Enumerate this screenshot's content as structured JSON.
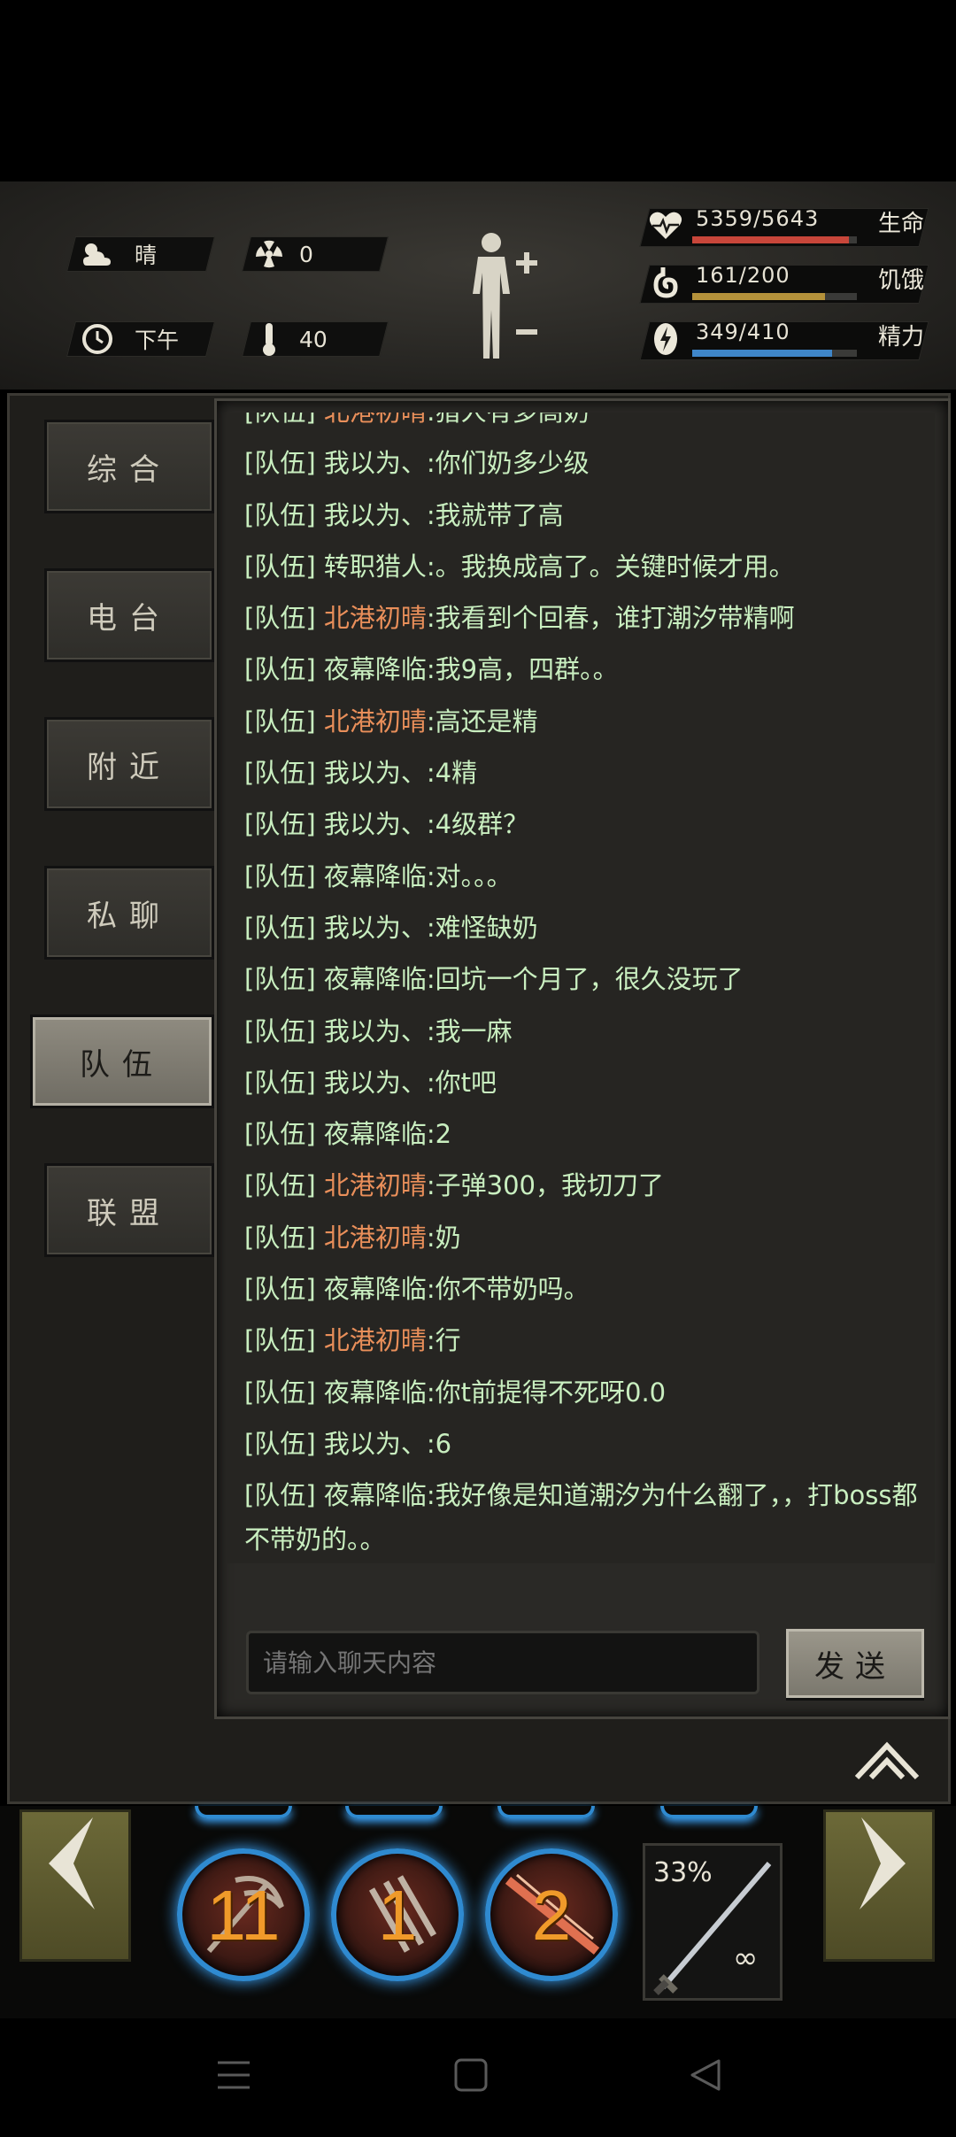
{
  "status": {
    "weather": "晴",
    "radiation": "0",
    "time_of_day": "下午",
    "temperature": "40"
  },
  "stats": [
    {
      "label": "生命",
      "value": "5359/5643",
      "fraction": 0.95,
      "color": "#c8463a",
      "icon": "heart-pulse-icon"
    },
    {
      "label": "饥饿",
      "value": "161/200",
      "fraction": 0.805,
      "color": "#b4913a",
      "icon": "stomach-icon"
    },
    {
      "label": "精力",
      "value": "349/410",
      "fraction": 0.851,
      "color": "#3f86c9",
      "icon": "energy-icon"
    }
  ],
  "tabs": [
    {
      "label": "综合",
      "active": false
    },
    {
      "label": "电台",
      "active": false
    },
    {
      "label": "附近",
      "active": false
    },
    {
      "label": "私聊",
      "active": false
    },
    {
      "label": "队伍",
      "active": true
    },
    {
      "label": "联盟",
      "active": false
    }
  ],
  "chat": {
    "channel_tag": "[队伍]",
    "messages": [
      {
        "name": "北港初晴",
        "name_color": "orange",
        "text": ":猎人有多高奶"
      },
      {
        "name": "我以为、",
        "name_color": "green",
        "text": ":你们奶多少级"
      },
      {
        "name": "我以为、",
        "name_color": "green",
        "text": ":我就带了高"
      },
      {
        "name": "转职猎人",
        "name_color": "green",
        "text": ":。我换成高了。关键时候才用。"
      },
      {
        "name": "北港初晴",
        "name_color": "orange",
        "text": ":我看到个回春，谁打潮汐带精啊"
      },
      {
        "name": "夜幕降临",
        "name_color": "green",
        "text": ":我9高，四群。。"
      },
      {
        "name": "北港初晴",
        "name_color": "orange",
        "text": ":高还是精"
      },
      {
        "name": "我以为、",
        "name_color": "green",
        "text": ":4精"
      },
      {
        "name": "我以为、",
        "name_color": "green",
        "text": ":4级群？"
      },
      {
        "name": "夜幕降临",
        "name_color": "green",
        "text": ":对。。。"
      },
      {
        "name": "我以为、",
        "name_color": "green",
        "text": ":难怪缺奶"
      },
      {
        "name": "夜幕降临",
        "name_color": "green",
        "text": ":回坑一个月了，很久没玩了"
      },
      {
        "name": "我以为、",
        "name_color": "green",
        "text": ":我一麻"
      },
      {
        "name": "我以为、",
        "name_color": "green",
        "text": ":你t吧"
      },
      {
        "name": "夜幕降临",
        "name_color": "green",
        "text": ":2"
      },
      {
        "name": "北港初晴",
        "name_color": "orange",
        "text": ":子弹300，我切刀了"
      },
      {
        "name": "北港初晴",
        "name_color": "orange",
        "text": ":奶"
      },
      {
        "name": "夜幕降临",
        "name_color": "green",
        "text": ":你不带奶吗。"
      },
      {
        "name": "北港初晴",
        "name_color": "orange",
        "text": ":行"
      },
      {
        "name": "夜幕降临",
        "name_color": "green",
        "text": ":你t前提得不死呀0.0"
      },
      {
        "name": "我以为、",
        "name_color": "green",
        "text": ":6"
      },
      {
        "name": "夜幕降临",
        "name_color": "green",
        "text": ":我好像是知道潮汐为什么翻了，，打boss都不带奶的。。"
      }
    ],
    "input_placeholder": "请输入聊天内容",
    "send_label": "发送"
  },
  "skills": [
    {
      "count": "11",
      "icon": "scythe-skill-icon"
    },
    {
      "count": "1",
      "icon": "claw-skill-icon"
    },
    {
      "count": "2",
      "icon": "slash-skill-icon"
    }
  ],
  "weapon": {
    "durability": "33%",
    "ammo": "∞",
    "icon": "sword-icon"
  }
}
